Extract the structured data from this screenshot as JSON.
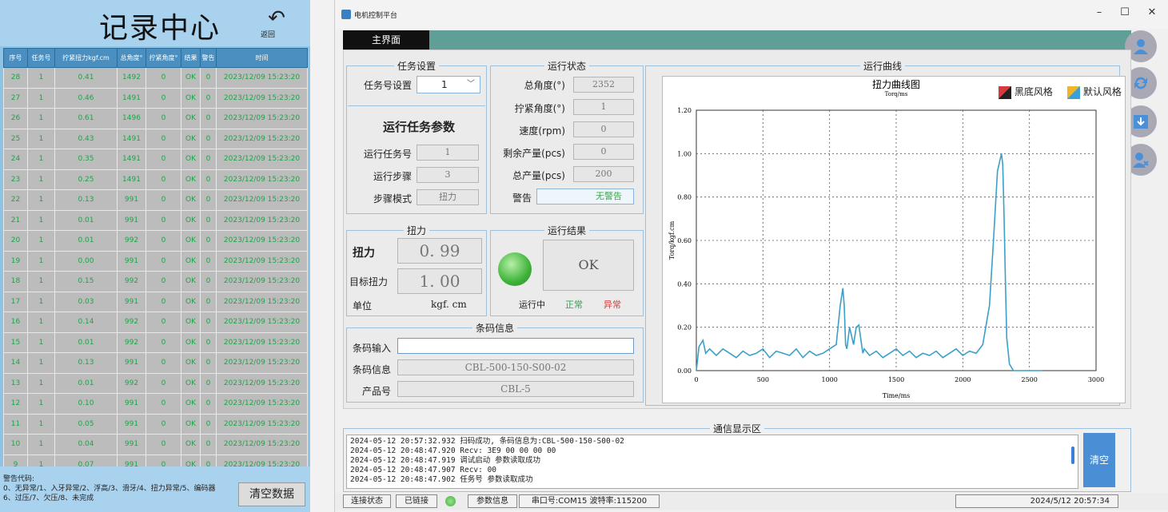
{
  "records": {
    "title": "记录中心",
    "back_label": "返回",
    "columns": [
      "序号",
      "任务号",
      "拧紧扭力kgf.cm",
      "总角度°",
      "拧紧角度°",
      "结果",
      "警告",
      "时间"
    ],
    "rows": [
      [
        "28",
        "1",
        "0.41",
        "1492",
        "0",
        "OK",
        "0",
        "2023/12/09 15:23:20"
      ],
      [
        "27",
        "1",
        "0.46",
        "1491",
        "0",
        "OK",
        "0",
        "2023/12/09 15:23:20"
      ],
      [
        "26",
        "1",
        "0.61",
        "1496",
        "0",
        "OK",
        "0",
        "2023/12/09 15:23:20"
      ],
      [
        "25",
        "1",
        "0.43",
        "1491",
        "0",
        "OK",
        "0",
        "2023/12/09 15:23:20"
      ],
      [
        "24",
        "1",
        "0.35",
        "1491",
        "0",
        "OK",
        "0",
        "2023/12/09 15:23:20"
      ],
      [
        "23",
        "1",
        "0.25",
        "1491",
        "0",
        "OK",
        "0",
        "2023/12/09 15:23:20"
      ],
      [
        "22",
        "1",
        "0.13",
        "991",
        "0",
        "OK",
        "0",
        "2023/12/09 15:23:20"
      ],
      [
        "21",
        "1",
        "0.01",
        "991",
        "0",
        "OK",
        "0",
        "2023/12/09 15:23:20"
      ],
      [
        "20",
        "1",
        "0.01",
        "992",
        "0",
        "OK",
        "0",
        "2023/12/09 15:23:20"
      ],
      [
        "19",
        "1",
        "0.00",
        "991",
        "0",
        "OK",
        "0",
        "2023/12/09 15:23:20"
      ],
      [
        "18",
        "1",
        "0.15",
        "992",
        "0",
        "OK",
        "0",
        "2023/12/09 15:23:20"
      ],
      [
        "17",
        "1",
        "0.03",
        "991",
        "0",
        "OK",
        "0",
        "2023/12/09 15:23:20"
      ],
      [
        "16",
        "1",
        "0.14",
        "992",
        "0",
        "OK",
        "0",
        "2023/12/09 15:23:20"
      ],
      [
        "15",
        "1",
        "0.01",
        "992",
        "0",
        "OK",
        "0",
        "2023/12/09 15:23:20"
      ],
      [
        "14",
        "1",
        "0.13",
        "991",
        "0",
        "OK",
        "0",
        "2023/12/09 15:23:20"
      ],
      [
        "13",
        "1",
        "0.01",
        "992",
        "0",
        "OK",
        "0",
        "2023/12/09 15:23:20"
      ],
      [
        "12",
        "1",
        "0.10",
        "991",
        "0",
        "OK",
        "0",
        "2023/12/09 15:23:20"
      ],
      [
        "11",
        "1",
        "0.05",
        "991",
        "0",
        "OK",
        "0",
        "2023/12/09 15:23:20"
      ],
      [
        "10",
        "1",
        "0.04",
        "991",
        "0",
        "OK",
        "0",
        "2023/12/09 15:23:20"
      ],
      [
        "9",
        "1",
        "0.07",
        "991",
        "0",
        "OK",
        "0",
        "2023/12/09 15:23:20"
      ]
    ],
    "warn_title": "警告代码:",
    "warn_line1": "0、无异常/1、入牙异常/2、浮高/3、滑牙/4、扭力异常/5、编码器",
    "warn_line2": "6、过压/7、欠压/8、未完成",
    "clear_label": "清空数据"
  },
  "window": {
    "title": "电机控制平台",
    "min": "–",
    "max": "☐",
    "close": "✕",
    "tab_main": "主界面"
  },
  "task": {
    "legend": "任务设置",
    "task_no_label": "任务号设置",
    "task_no_value": "1",
    "params_title": "运行任务参数",
    "run_task_label": "运行任务号",
    "run_task_value": "1",
    "run_step_label": "运行步骤",
    "run_step_value": "3",
    "step_mode_label": "步骤模式",
    "step_mode_value": "扭力"
  },
  "status": {
    "legend": "运行状态",
    "total_angle_label": "总角度(°)",
    "total_angle_value": "2352",
    "tight_angle_label": "拧紧角度(°)",
    "tight_angle_value": "1",
    "speed_label": "速度(rpm)",
    "speed_value": "0",
    "remain_label": "剩余产量(pcs)",
    "remain_value": "0",
    "total_label": "总产量(pcs)",
    "total_value": "200",
    "warn_label": "警告",
    "warn_value": "无警告"
  },
  "torque": {
    "legend": "扭力",
    "torque_label": "扭力",
    "torque_value": "0. 99",
    "target_label": "目标扭力",
    "target_value": "1. 00",
    "unit_label": "单位",
    "unit_value": "kgf. cm"
  },
  "result": {
    "legend": "运行结果",
    "value": "OK",
    "running": "运行中",
    "normal": "正常",
    "abnormal": "异常"
  },
  "barcode": {
    "legend": "条码信息",
    "input_label": "条码输入",
    "input_value": "",
    "info_label": "条码信息",
    "info_value": "CBL-500-150-S00-02",
    "product_label": "产品号",
    "product_value": "CBL-5"
  },
  "curve": {
    "legend": "运行曲线",
    "style_dark": "黑底风格",
    "style_default": "默认风格"
  },
  "chart_data": {
    "type": "line",
    "title": "扭力曲线图",
    "subtitle": "Torq/ms",
    "xlabel": "Time/ms",
    "ylabel": "Torq/kgf.cm",
    "xlim": [
      0,
      3000
    ],
    "ylim": [
      0,
      1.2
    ],
    "xticks": [
      0,
      500,
      1000,
      1500,
      2000,
      2500,
      3000
    ],
    "yticks": [
      0.0,
      0.2,
      0.4,
      0.6,
      0.8,
      1.0,
      1.2
    ],
    "xtick_labels": [
      "0",
      "500",
      "1000",
      "1500",
      "2000",
      "2500",
      "3000"
    ],
    "ytick_labels": [
      "0.00",
      "0.20",
      "0.40",
      "0.60",
      "0.80",
      "1.00",
      "1.20"
    ],
    "grid": true,
    "series": [
      {
        "color": "#3aa0c8",
        "x": [
          0,
          20,
          50,
          70,
          100,
          150,
          200,
          250,
          300,
          350,
          400,
          450,
          500,
          550,
          600,
          650,
          700,
          750,
          800,
          850,
          900,
          950,
          1000,
          1050,
          1080,
          1100,
          1110,
          1120,
          1130,
          1150,
          1180,
          1200,
          1220,
          1240,
          1250,
          1260,
          1300,
          1350,
          1400,
          1450,
          1500,
          1550,
          1600,
          1650,
          1700,
          1750,
          1800,
          1850,
          1900,
          1950,
          2000,
          2050,
          2100,
          2150,
          2200,
          2230,
          2260,
          2290,
          2300,
          2310,
          2320,
          2330,
          2350,
          2380,
          2400,
          2600
        ],
        "y": [
          0.0,
          0.11,
          0.14,
          0.08,
          0.1,
          0.07,
          0.1,
          0.08,
          0.06,
          0.09,
          0.07,
          0.08,
          0.1,
          0.06,
          0.09,
          0.08,
          0.07,
          0.1,
          0.06,
          0.09,
          0.07,
          0.08,
          0.1,
          0.12,
          0.3,
          0.38,
          0.3,
          0.12,
          0.1,
          0.2,
          0.12,
          0.2,
          0.21,
          0.12,
          0.08,
          0.1,
          0.07,
          0.09,
          0.06,
          0.08,
          0.1,
          0.07,
          0.09,
          0.06,
          0.08,
          0.07,
          0.09,
          0.06,
          0.08,
          0.1,
          0.07,
          0.09,
          0.08,
          0.12,
          0.3,
          0.6,
          0.92,
          1.0,
          0.95,
          0.7,
          0.4,
          0.15,
          0.03,
          0.0,
          0.0,
          0.0
        ]
      }
    ]
  },
  "comm": {
    "legend": "通信显示区",
    "lines": [
      "2024-05-12 20:57:32.932 扫码成功, 条码信息为:CBL-500-150-S00-02",
      "2024-05-12 20:48:47.920 Recv: 3E9 00 00 00 00",
      "2024-05-12 20:48:47.919 调试启动 参数读取成功",
      "2024-05-12 20:48:47.907 Recv: 00",
      "2024-05-12 20:48:47.902 任务号 参数读取成功"
    ],
    "clear_label": "清空"
  },
  "statusbar": {
    "conn_label": "连接状态",
    "conn_value": "已链接",
    "params_label": "参数信息",
    "port_info": "串口号:COM15 波特率:115200",
    "datetime": "2024/5/12 20:57:34"
  }
}
